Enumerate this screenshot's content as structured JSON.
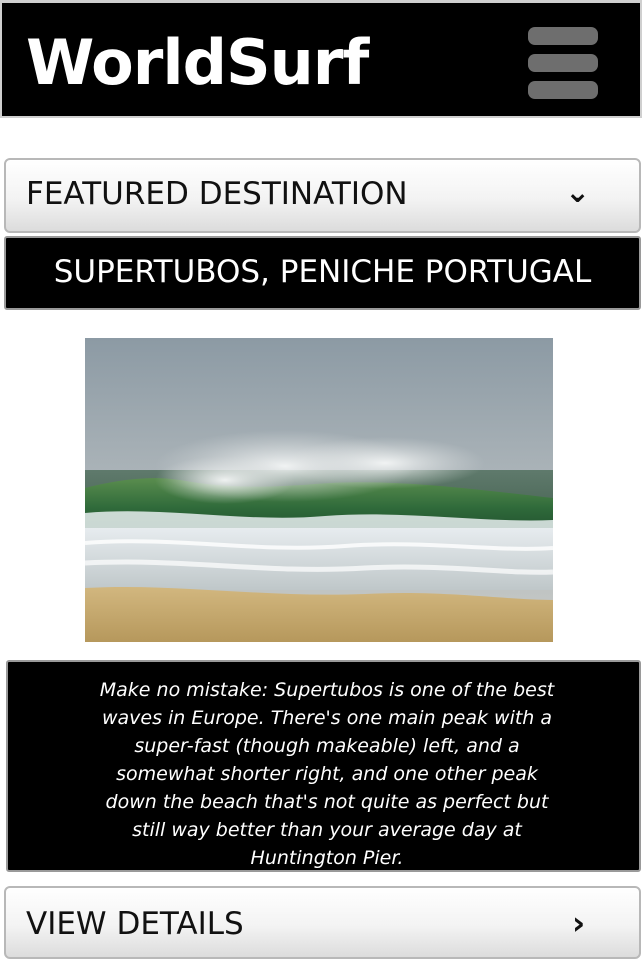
{
  "header": {
    "logo": "WorldSurf",
    "menu_icon": "hamburger-menu-icon"
  },
  "featured": {
    "label": "FEATURED DESTINATION",
    "icon": "chevron-down-icon"
  },
  "destination": {
    "title": "SUPERTUBOS, PENICHE PORTUGAL",
    "photo": "wave-photo",
    "description": "Make no mistake: Supertubos is one of the best waves in Europe. There's one main peak with a super-fast (though makeable) left, and a somewhat shorter right, and one other peak down the beach that's not quite as perfect but still way better than your average day at Huntington Pier."
  },
  "details": {
    "label": "VIEW DETAILS",
    "icon": "chevron-right-icon"
  },
  "colors": {
    "header_bg": "#000000",
    "menu_icon": "#6e6e6e",
    "bar_gradient_top": "#ffffff",
    "bar_gradient_bottom": "#dcdcdc",
    "text_light": "#ffffff",
    "text_dark": "#111111"
  }
}
